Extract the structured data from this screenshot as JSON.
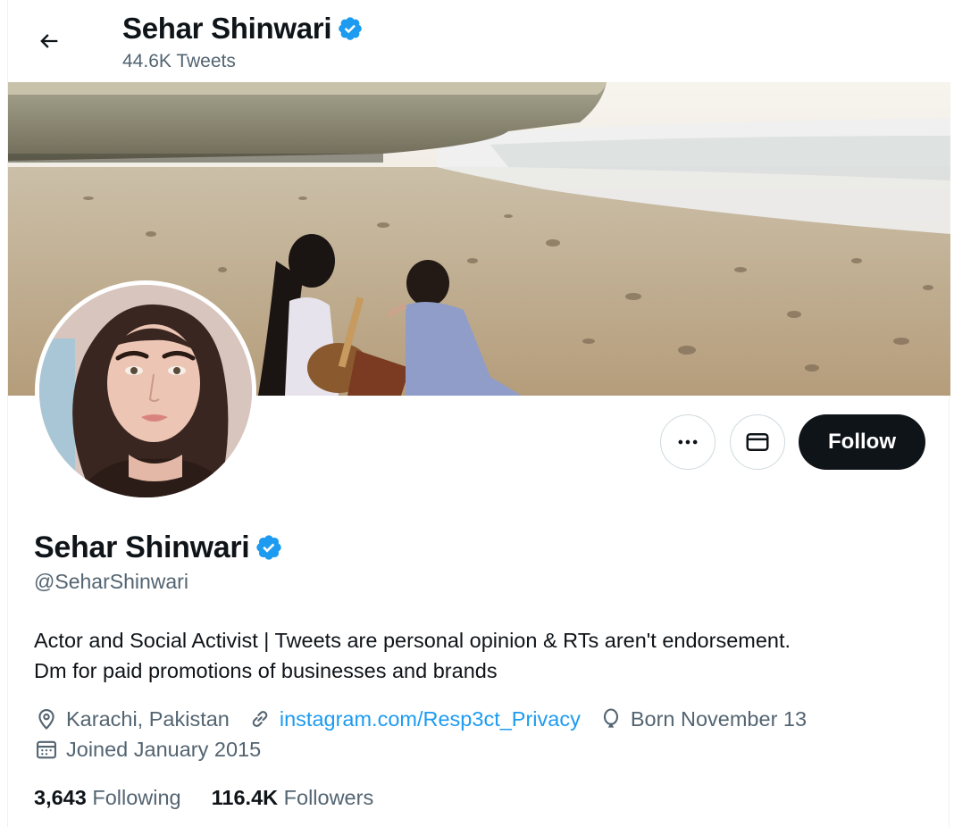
{
  "header": {
    "back_icon": "arrow-left-icon",
    "name": "Sehar Shinwari",
    "tweet_count": "44.6K Tweets"
  },
  "banner": {
    "description_icon": "beach-photo"
  },
  "actions": {
    "more_icon": "ellipsis-icon",
    "message_icon": "envelope-icon",
    "follow_label": "Follow"
  },
  "profile": {
    "display_name": "Sehar Shinwari",
    "verified_icon": "verified-badge-icon",
    "handle": "@SeharShinwari",
    "bio_line1": "Actor and Social Activist | Tweets are personal opinion & RTs aren't endorsement.",
    "bio_line2": "Dm for paid promotions of businesses and brands",
    "location": "Karachi, Pakistan",
    "website": "instagram.com/Resp3ct_Privacy",
    "birthday": "Born November 13",
    "joined": "Joined January 2015"
  },
  "stats": {
    "following_count": "3,643",
    "following_label": "Following",
    "followers_count": "116.4K",
    "followers_label": "Followers"
  },
  "colors": {
    "accent": "#1d9bf0",
    "text_primary": "#0f1419",
    "text_secondary": "#536471",
    "follow_bg": "#0f1419"
  }
}
